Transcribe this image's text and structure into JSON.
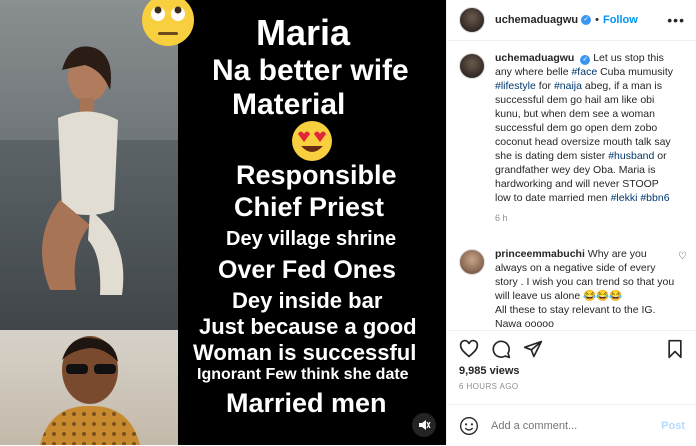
{
  "media": {
    "caption_lines": [
      "Maria",
      "Na better wife",
      "Material",
      "Responsible",
      "Chief  Priest",
      "Dey village shrine",
      "Over Fed Ones",
      "Dey inside bar",
      "Just because a good",
      "Woman is successful",
      "Ignorant  Few think she date",
      "Married men"
    ],
    "emoji_top": "rolling-eyes-emoji",
    "emoji_mid": "heart-eyes-emoji",
    "mute_icon": "speaker-muted-icon"
  },
  "header": {
    "username": "uchemaduagwu",
    "dot": "•",
    "follow_label": "Follow",
    "more_icon": "more-options-icon"
  },
  "caption": {
    "username": "uchemaduagwu",
    "text_parts": [
      {
        "t": "Let us stop this any where belle ",
        "tag": false
      },
      {
        "t": "#face",
        "tag": true
      },
      {
        "t": " Cuba mumusity ",
        "tag": false
      },
      {
        "t": "#lifestyle",
        "tag": true
      },
      {
        "t": " for ",
        "tag": false
      },
      {
        "t": "#naija",
        "tag": true
      },
      {
        "t": " abeg, if a man is successful dem go hail am like obi kunu, but when dem see a woman successful dem go open dem zobo coconut head oversize mouth talk say she is dating dem sister ",
        "tag": false
      },
      {
        "t": "#husband",
        "tag": true
      },
      {
        "t": " or grandfather wey dey Oba. Maria is hardworking and will never STOOP low to date married men ",
        "tag": false
      },
      {
        "t": "#lekki",
        "tag": true
      },
      {
        "t": " ",
        "tag": false
      },
      {
        "t": "#bbn6",
        "tag": true
      }
    ],
    "time": "6 h"
  },
  "comment": {
    "username": "princeemmabuchi",
    "text": "Why are you always on a negative side of every story . I wish you can trend so that you will leave us alone 😂😂😂",
    "text2": "All these to stay relevant to the IG. Nawa ooooo"
  },
  "actions": {
    "like_icon": "heart-icon",
    "comment_icon": "comment-icon",
    "share_icon": "share-icon",
    "save_icon": "bookmark-icon",
    "views": "9,985 views",
    "ago": "6 HOURS AGO"
  },
  "add_comment": {
    "placeholder": "Add a comment...",
    "post_label": "Post"
  },
  "colors": {
    "accent": "#0095f6",
    "post_disabled": "#b3dbff",
    "hashtag": "#00376b",
    "muted_text": "#8e8e8e"
  }
}
